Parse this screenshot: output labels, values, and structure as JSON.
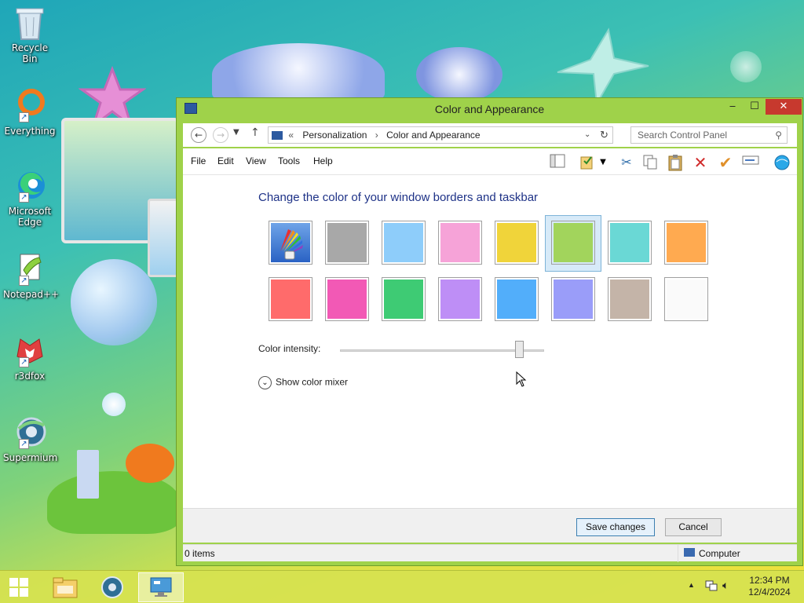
{
  "desktop": {
    "icons": [
      {
        "label": "Recycle Bin",
        "icon": "recycle-bin-icon"
      },
      {
        "label": "Everything",
        "icon": "everything-search-icon"
      },
      {
        "label": "Microsoft Edge",
        "icon": "edge-icon"
      },
      {
        "label": "Notepad++",
        "icon": "notepad-plus-plus-icon"
      },
      {
        "label": "r3dfox",
        "icon": "r3dfox-icon"
      },
      {
        "label": "Supermium",
        "icon": "supermium-icon"
      }
    ]
  },
  "window": {
    "title": "Color and Appearance",
    "accent_color": "#9fd24a",
    "controls": {
      "minimize": "‒",
      "maximize": "☐",
      "close": "✕"
    },
    "breadcrumb": {
      "prefix": "«",
      "items": [
        "Personalization",
        "Color and Appearance"
      ],
      "separator": "›"
    },
    "search_placeholder": "Search Control Panel",
    "menu": [
      "File",
      "Edit",
      "View",
      "Tools",
      "Help"
    ],
    "toolbar_icons": [
      "layout-icon",
      "properties-icon",
      "dropdown-icon",
      "cut-icon",
      "copy-icon",
      "paste-icon",
      "delete-icon",
      "checkmark-icon",
      "rename-icon",
      "globe-icon"
    ],
    "heading": "Change the color of your window borders and taskbar",
    "swatches": {
      "row1": [
        "auto",
        "#a8a8a8",
        "#8ecdfa",
        "#f6a3d8",
        "#f0d43a",
        "#a2d45c",
        "#6ad8d5",
        "#ffaa50"
      ],
      "row2": [
        "#ff6b6b",
        "#f259b5",
        "#3ecb74",
        "#be8ef6",
        "#52aefa",
        "#9a9df9",
        "#c4b4a8",
        "#fafafa"
      ],
      "selected_index": 5
    },
    "intensity_label": "Color intensity:",
    "intensity_value": 0.88,
    "mixer_label": "Show color mixer",
    "save_label": "Save changes",
    "cancel_label": "Cancel",
    "status_items": "0 items",
    "status_location": "Computer"
  },
  "taskbar": {
    "time": "12:34 PM",
    "date": "12/4/2024"
  }
}
